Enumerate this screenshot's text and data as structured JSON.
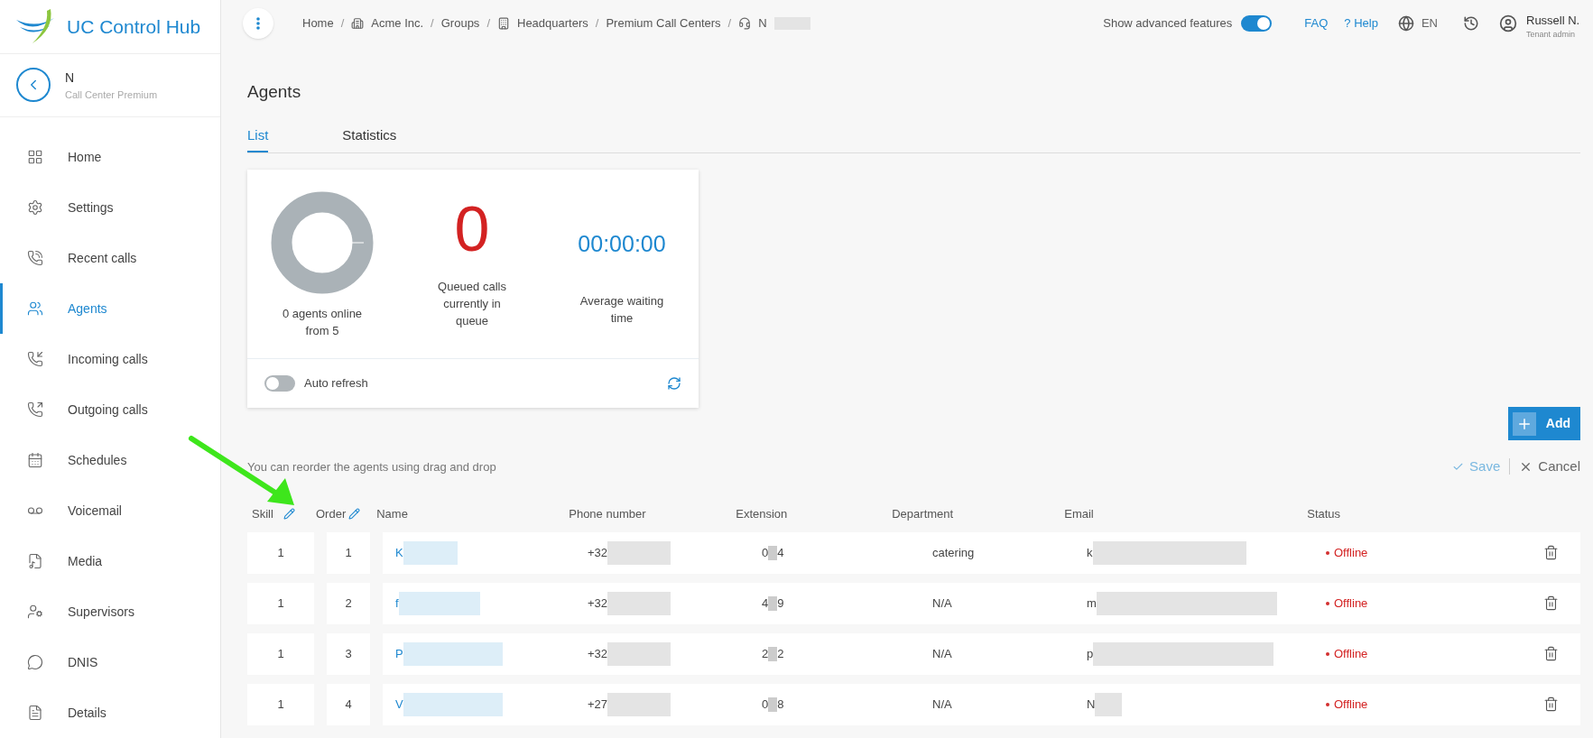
{
  "app": {
    "name": "UC Control Hub"
  },
  "context": {
    "title": "N",
    "subtitle": "Call Center Premium"
  },
  "sidebar": {
    "items": [
      {
        "label": "Home",
        "selected": false
      },
      {
        "label": "Settings",
        "selected": false
      },
      {
        "label": "Recent calls",
        "selected": false
      },
      {
        "label": "Agents",
        "selected": true
      },
      {
        "label": "Incoming calls",
        "selected": false
      },
      {
        "label": "Outgoing calls",
        "selected": false
      },
      {
        "label": "Schedules",
        "selected": false
      },
      {
        "label": "Voicemail",
        "selected": false
      },
      {
        "label": "Media",
        "selected": false
      },
      {
        "label": "Supervisors",
        "selected": false
      },
      {
        "label": "DNIS",
        "selected": false
      },
      {
        "label": "Details",
        "selected": false
      }
    ]
  },
  "breadcrumb_separator": "/",
  "breadcrumb": [
    {
      "label": "Home",
      "kind": "plain"
    },
    {
      "label": "Acme Inc.",
      "kind": "company"
    },
    {
      "label": "Groups",
      "kind": "plain"
    },
    {
      "label": "Headquarters",
      "kind": "building"
    },
    {
      "label": "Premium Call Centers",
      "kind": "plain"
    },
    {
      "label": "N",
      "kind": "callcenter"
    }
  ],
  "header": {
    "advanced_label": "Show advanced features",
    "advanced_on": true,
    "faq": "FAQ",
    "help": "? Help",
    "language": "EN",
    "user_name": "Russell N.",
    "user_role": "Tenant admin"
  },
  "page_title": "Agents",
  "tabs": [
    {
      "label": "List",
      "selected": true
    },
    {
      "label": "Statistics",
      "selected": false
    }
  ],
  "stats": {
    "online_label": "0 agents online from 5",
    "queued_value": "0",
    "queued_label": "Queued calls currently in queue",
    "wait_value": "00:00:00",
    "wait_label": "Average waiting time",
    "auto_refresh_label": "Auto refresh",
    "auto_refresh_on": false
  },
  "add_button": "Add",
  "hint": "You can reorder the agents using drag and drop",
  "save": "Save",
  "cancel": "Cancel",
  "table": {
    "columns": [
      "Skill",
      "Order",
      "Name",
      "Phone number",
      "Extension",
      "Department",
      "Email",
      "Status"
    ],
    "rows": [
      {
        "skill": "1",
        "order": "1",
        "name": "K",
        "phone": "+32",
        "ext_start": "0",
        "ext_end": "4",
        "department": "catering",
        "email": "k",
        "status": "Offline",
        "color": "#d32f2f"
      },
      {
        "skill": "1",
        "order": "2",
        "name": "f",
        "phone": "+32",
        "ext_start": "4",
        "ext_end": "9",
        "department": "N/A",
        "email": "m",
        "status": "Offline",
        "color": "#d32f2f"
      },
      {
        "skill": "1",
        "order": "3",
        "name": "P",
        "phone": "+32",
        "ext_start": "2",
        "ext_end": "2",
        "department": "N/A",
        "email": "p",
        "status": "Offline",
        "color": "#d32f2f"
      },
      {
        "skill": "1",
        "order": "4",
        "name": "V",
        "phone": "+27",
        "ext_start": "0",
        "ext_end": "8",
        "department": "N/A",
        "email": "N",
        "status": "Offline",
        "color": "#d32f2f"
      }
    ]
  }
}
